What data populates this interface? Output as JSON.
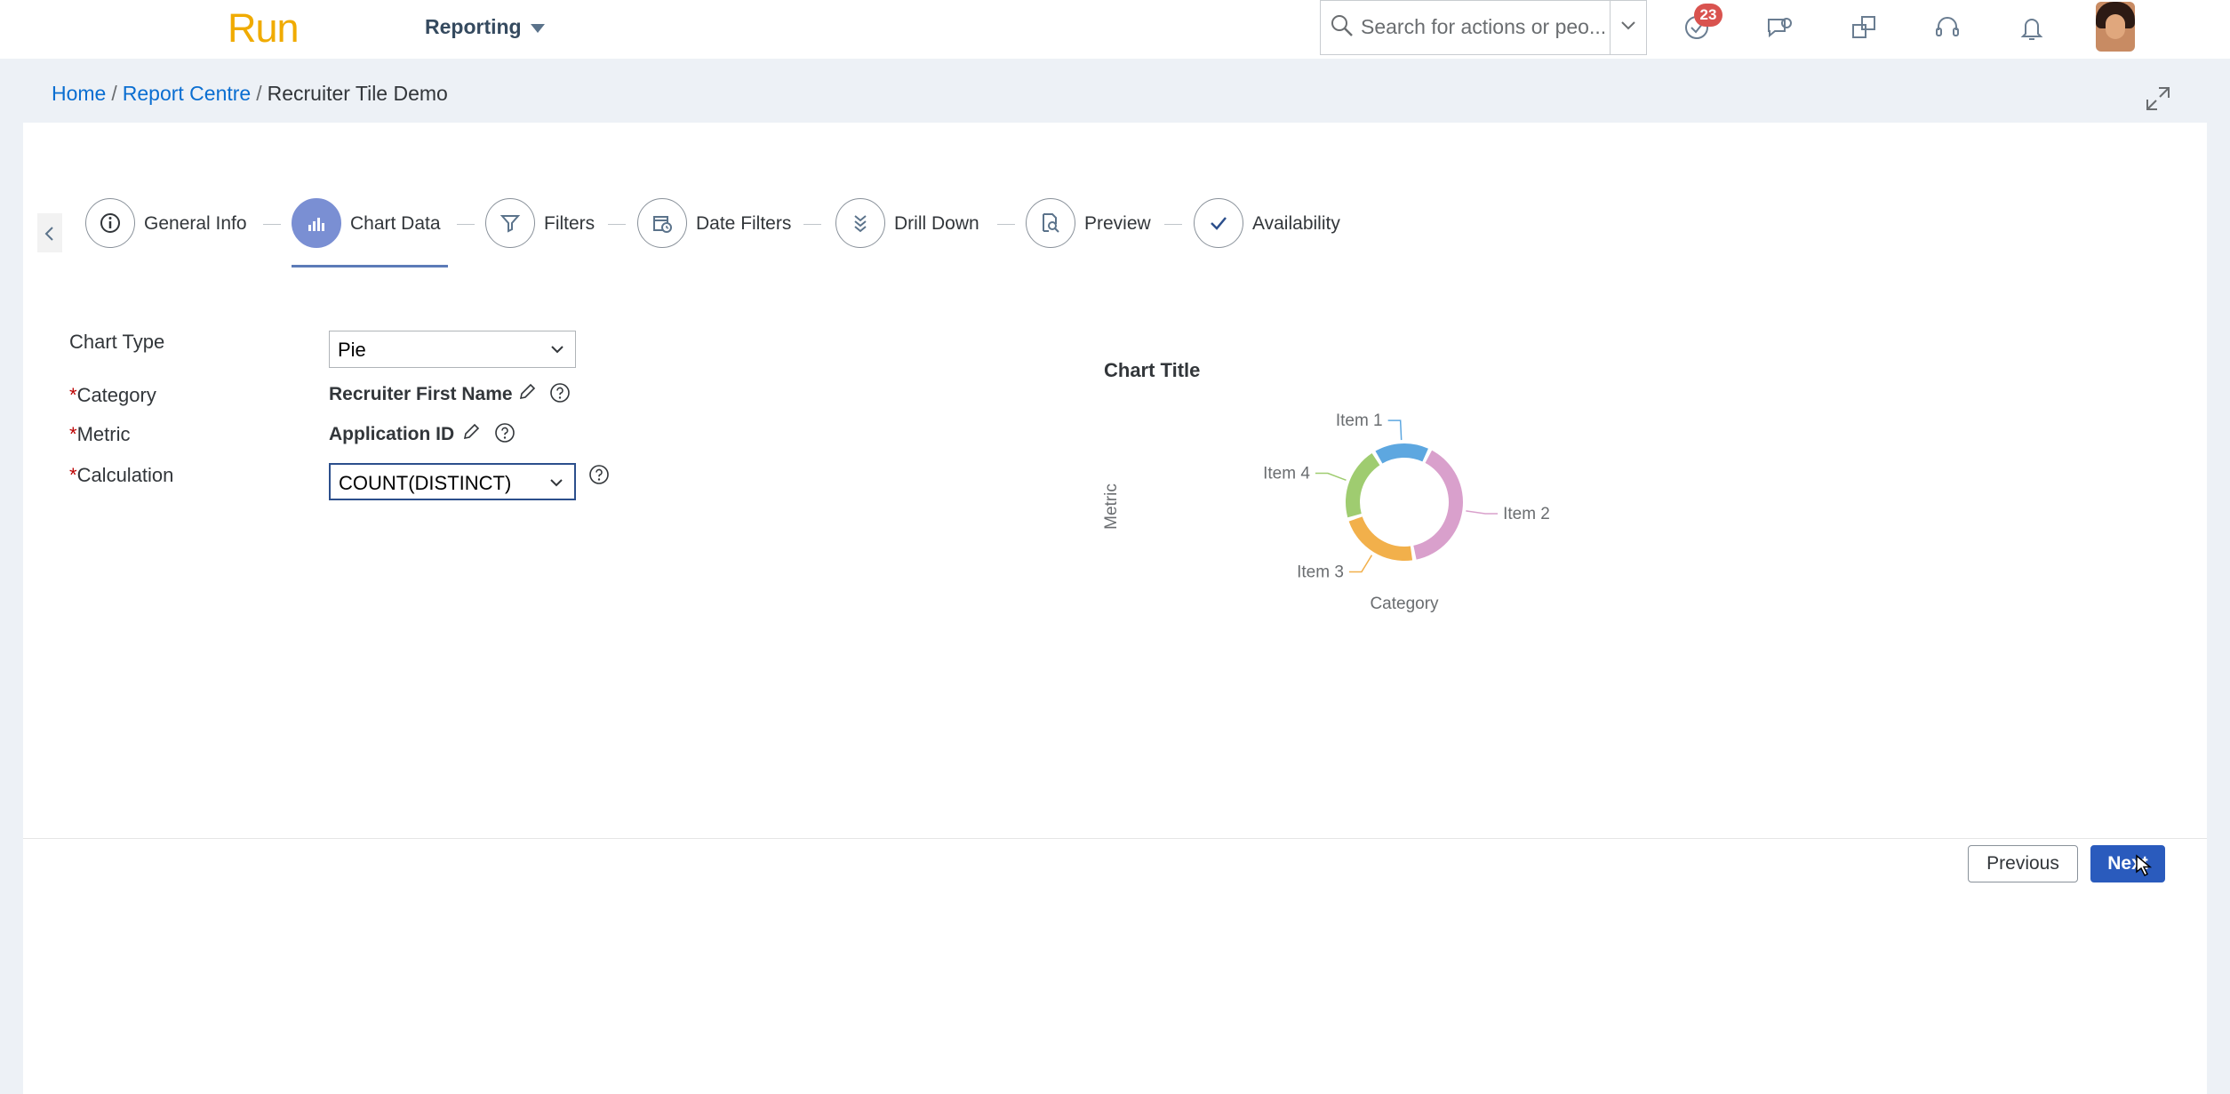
{
  "shell": {
    "logo": "Run",
    "menu_label": "Reporting",
    "search_placeholder": "Search for actions or peo...",
    "notification_count": "23",
    "icons": [
      "todo-check-icon",
      "feedback-icon",
      "people-connect-icon",
      "headset-icon",
      "bell-icon"
    ]
  },
  "breadcrumb": {
    "home": "Home",
    "sep1": "/",
    "report_centre": "Report Centre",
    "sep2": "/",
    "current": "Recruiter Tile Demo"
  },
  "wizard": {
    "steps": [
      {
        "label": "General Info",
        "icon": "info-icon"
      },
      {
        "label": "Chart Data",
        "icon": "bar-chart-icon",
        "active": true
      },
      {
        "label": "Filters",
        "icon": "filter-icon"
      },
      {
        "label": "Date Filters",
        "icon": "date-filter-icon"
      },
      {
        "label": "Drill Down",
        "icon": "drill-down-icon"
      },
      {
        "label": "Preview",
        "icon": "preview-icon"
      },
      {
        "label": "Availability",
        "icon": "checkmark-icon"
      }
    ]
  },
  "form": {
    "chart_type": {
      "label": "Chart Type",
      "value": "Pie"
    },
    "category": {
      "required_mark": "*",
      "label": "Category",
      "value": "Recruiter First Name"
    },
    "metric": {
      "required_mark": "*",
      "label": "Metric",
      "value": "Application ID"
    },
    "calculation": {
      "required_mark": "*",
      "label": "Calculation",
      "value": "COUNT(DISTINCT)"
    }
  },
  "chart_data": {
    "type": "pie",
    "title": "Chart Title",
    "xlabel": "Category",
    "ylabel": "Metric",
    "donut": true,
    "slices": [
      {
        "label": "Item 1",
        "value": 16,
        "color": "#5da7e0"
      },
      {
        "label": "Item 2",
        "value": 40,
        "color": "#d9a0cc"
      },
      {
        "label": "Item 3",
        "value": 23,
        "color": "#f2b04b"
      },
      {
        "label": "Item 4",
        "value": 21,
        "color": "#9fcc70"
      }
    ]
  },
  "footer": {
    "previous_label": "Previous",
    "next_label": "Next"
  }
}
